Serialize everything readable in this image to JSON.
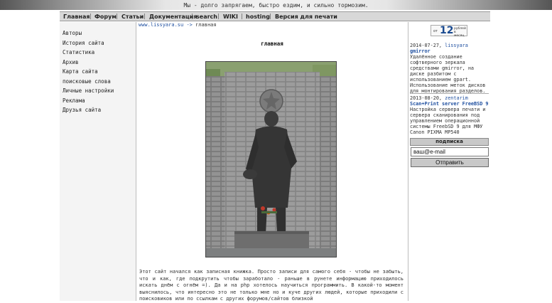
{
  "header": {
    "slogan": "Мы - долго запрягаем, быстро ездим, и сильно тормозим."
  },
  "nav": [
    "Главная",
    "Форум",
    "Статьи",
    "Документация",
    "search",
    "WIKI",
    "hosting",
    "Версия для печати"
  ],
  "sidebar": [
    "Авторы",
    "История сайта",
    "Статистика",
    "Архив",
    "Карта сайта",
    "поисковые слова",
    "Личные настройки",
    "Реклама",
    "Друзья сайта"
  ],
  "breadcrumb": {
    "site": "www.lissyara.su",
    "arrow": "->",
    "current": "главная"
  },
  "page": {
    "heading": "главная"
  },
  "article": {
    "text": "Этот сайт начался как записная книжка. Просто записи для самого себя - чтобы не забыть, что и как, где подкрутить чтобы заработало - раньше в рунете информацию приходилось искать днём с огнём =). Да и на php хотелось научиться программить. В какой-то момент выяснилось, что интересно это не только мне но и куче других людей, которые приходили с поисковиков или по ссылкам с других форумов/сайтов близкой"
  },
  "banner": {
    "pre": "от",
    "number": "12",
    "post1": "рублей",
    "post2": "в месяц"
  },
  "news": [
    {
      "date": "2014-07-27,",
      "author": "lissyara",
      "title": "gmirror",
      "text": "Удалённое создание софтверного зеркала средствами gmirror, на диске разбитом с использованием gpart. Использование меток дисков для монтирования разделов."
    },
    {
      "date": "2013-08-20,",
      "author": "zentarim",
      "title": "Scan+Print server FreeBSD 9",
      "text": "Настройка сервера печати и сервера сканирования под управлением операционной системы FreebSD 9 для МФУ Canon PIXMA MP540"
    }
  ],
  "subscribe": {
    "heading": "подписка",
    "input_value": "ваш@e-mail",
    "button": "Отправить"
  }
}
